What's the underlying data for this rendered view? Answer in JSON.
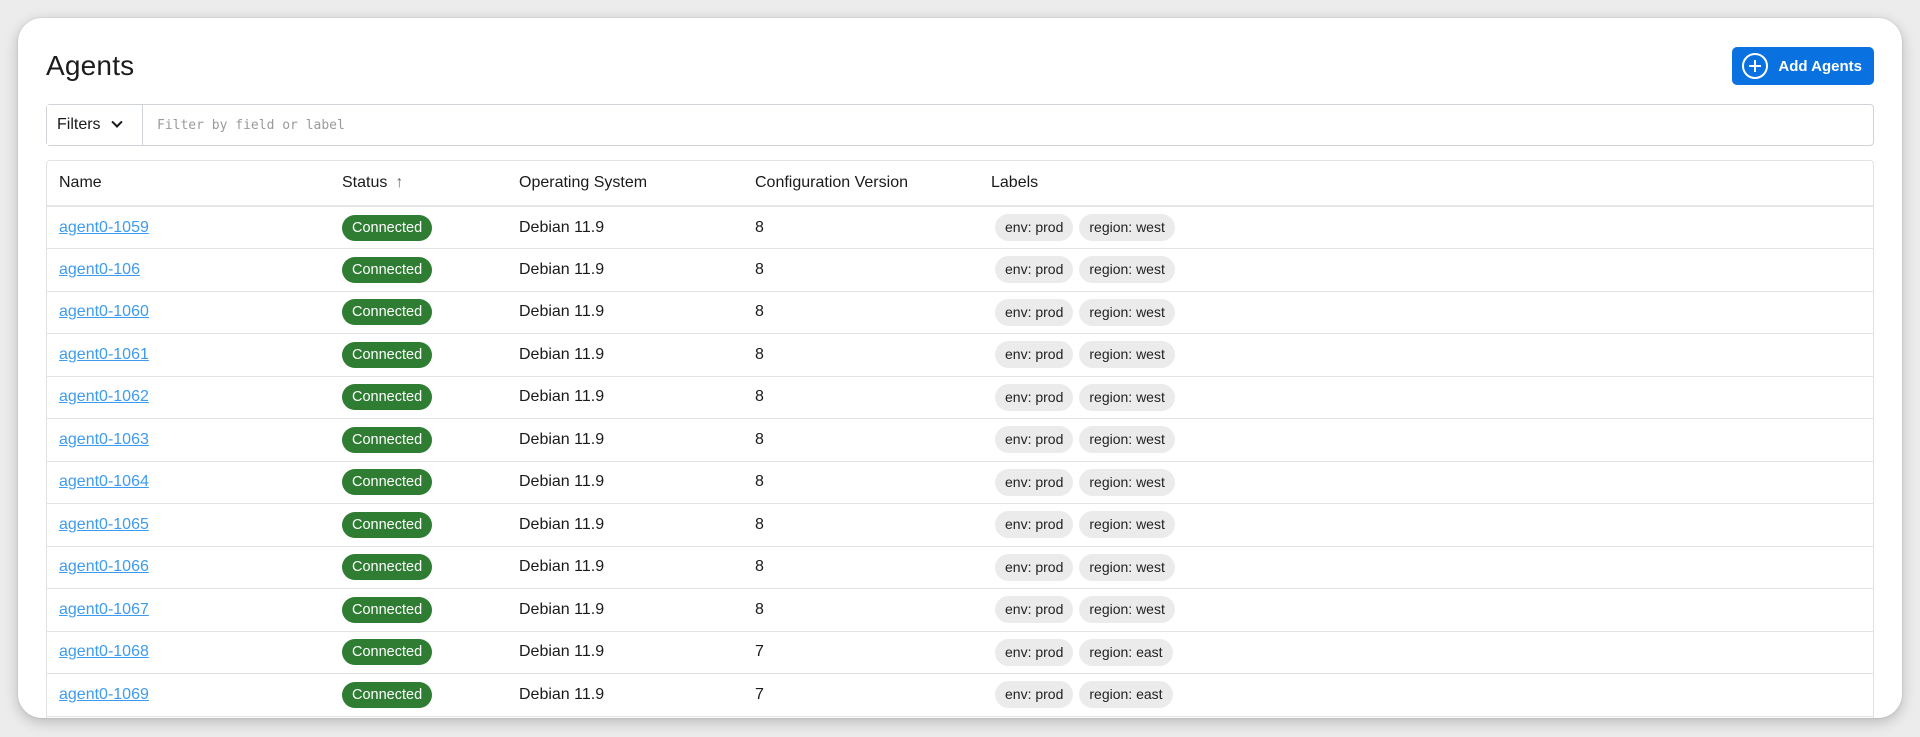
{
  "page": {
    "title": "Agents",
    "add_button_label": "Add Agents"
  },
  "filter": {
    "filters_label": "Filters",
    "placeholder": "Filter by field or label",
    "value": ""
  },
  "table": {
    "columns": [
      {
        "label": "Name"
      },
      {
        "label": "Status",
        "sort": "ascending",
        "sort_icon": "arrow-up-icon"
      },
      {
        "label": "Operating System"
      },
      {
        "label": "Configuration Version"
      },
      {
        "label": "Labels"
      }
    ],
    "rows": [
      {
        "name": "agent0-1059",
        "status": "Connected",
        "os": "Debian 11.9",
        "config_version": "8",
        "labels": [
          "env: prod",
          "region: west"
        ]
      },
      {
        "name": "agent0-106",
        "status": "Connected",
        "os": "Debian 11.9",
        "config_version": "8",
        "labels": [
          "env: prod",
          "region: west"
        ]
      },
      {
        "name": "agent0-1060",
        "status": "Connected",
        "os": "Debian 11.9",
        "config_version": "8",
        "labels": [
          "env: prod",
          "region: west"
        ]
      },
      {
        "name": "agent0-1061",
        "status": "Connected",
        "os": "Debian 11.9",
        "config_version": "8",
        "labels": [
          "env: prod",
          "region: west"
        ]
      },
      {
        "name": "agent0-1062",
        "status": "Connected",
        "os": "Debian 11.9",
        "config_version": "8",
        "labels": [
          "env: prod",
          "region: west"
        ]
      },
      {
        "name": "agent0-1063",
        "status": "Connected",
        "os": "Debian 11.9",
        "config_version": "8",
        "labels": [
          "env: prod",
          "region: west"
        ]
      },
      {
        "name": "agent0-1064",
        "status": "Connected",
        "os": "Debian 11.9",
        "config_version": "8",
        "labels": [
          "env: prod",
          "region: west"
        ]
      },
      {
        "name": "agent0-1065",
        "status": "Connected",
        "os": "Debian 11.9",
        "config_version": "8",
        "labels": [
          "env: prod",
          "region: west"
        ]
      },
      {
        "name": "agent0-1066",
        "status": "Connected",
        "os": "Debian 11.9",
        "config_version": "8",
        "labels": [
          "env: prod",
          "region: west"
        ]
      },
      {
        "name": "agent0-1067",
        "status": "Connected",
        "os": "Debian 11.9",
        "config_version": "8",
        "labels": [
          "env: prod",
          "region: west"
        ]
      },
      {
        "name": "agent0-1068",
        "status": "Connected",
        "os": "Debian 11.9",
        "config_version": "7",
        "labels": [
          "env: prod",
          "region: east"
        ]
      },
      {
        "name": "agent0-1069",
        "status": "Connected",
        "os": "Debian 11.9",
        "config_version": "7",
        "labels": [
          "env: prod",
          "region: east"
        ]
      }
    ]
  },
  "colors": {
    "primary": "#0a72e0",
    "status_connected": "#2e7d32",
    "link": "#3d9bf0",
    "label_chip_bg": "#ebebeb"
  }
}
